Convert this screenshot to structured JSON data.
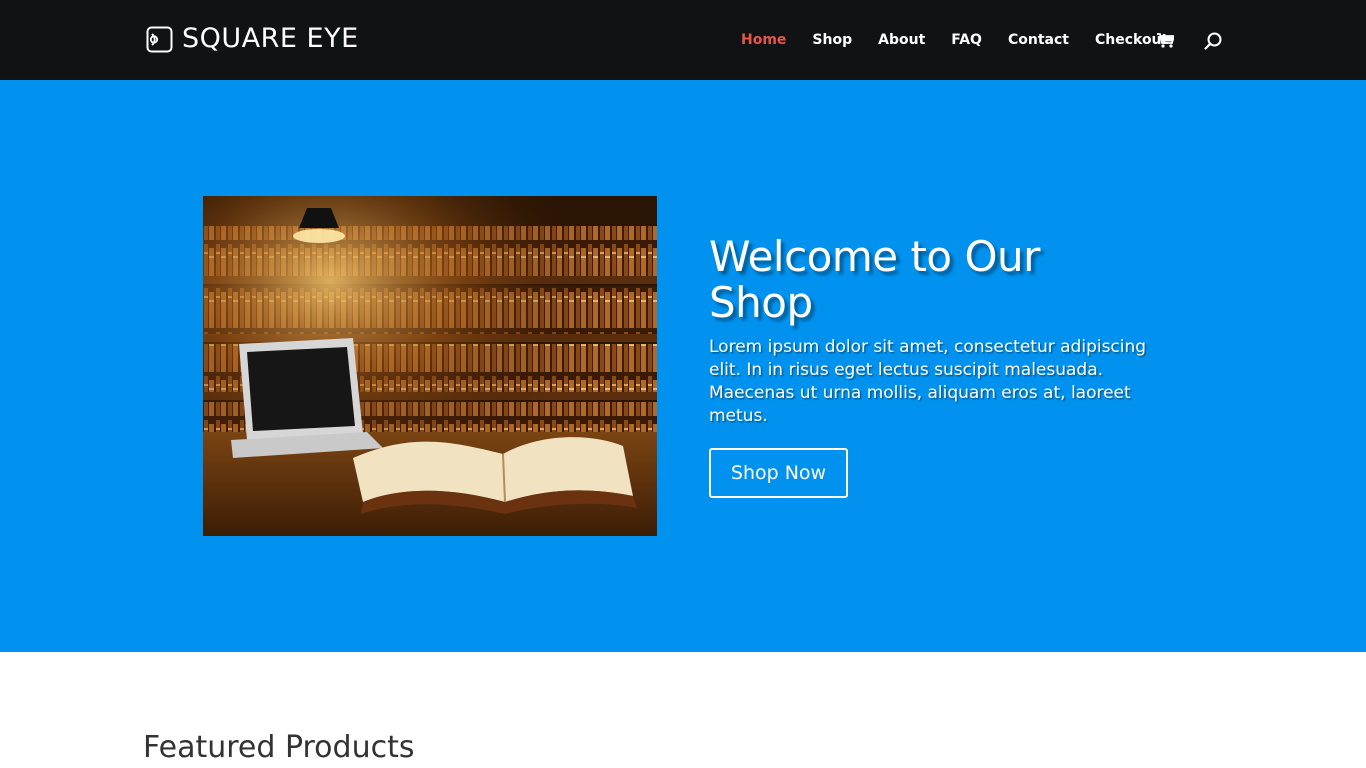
{
  "site": {
    "logo_text": "SQUARE EYE"
  },
  "nav": {
    "items": [
      {
        "label": "Home",
        "active": true
      },
      {
        "label": "Shop"
      },
      {
        "label": "About"
      },
      {
        "label": "FAQ"
      },
      {
        "label": "Contact"
      },
      {
        "label": "Checkout"
      }
    ],
    "cart_icon": "shopping-cart-icon",
    "search_icon": "search-icon"
  },
  "hero": {
    "title": "Welcome to Our Shop",
    "text": "Lorem ipsum dolor sit amet, consectetur adipiscing elit. In in risus eget lectus suscipit malesuada. Maecenas ut urna mollis, aliquam eros at, laoreet metus.",
    "button_label": "Shop Now",
    "background_color": "#0192ef"
  },
  "featured": {
    "title": "Featured Products"
  },
  "colors": {
    "header_bg": "#111213",
    "active_nav": "#e8564a"
  }
}
